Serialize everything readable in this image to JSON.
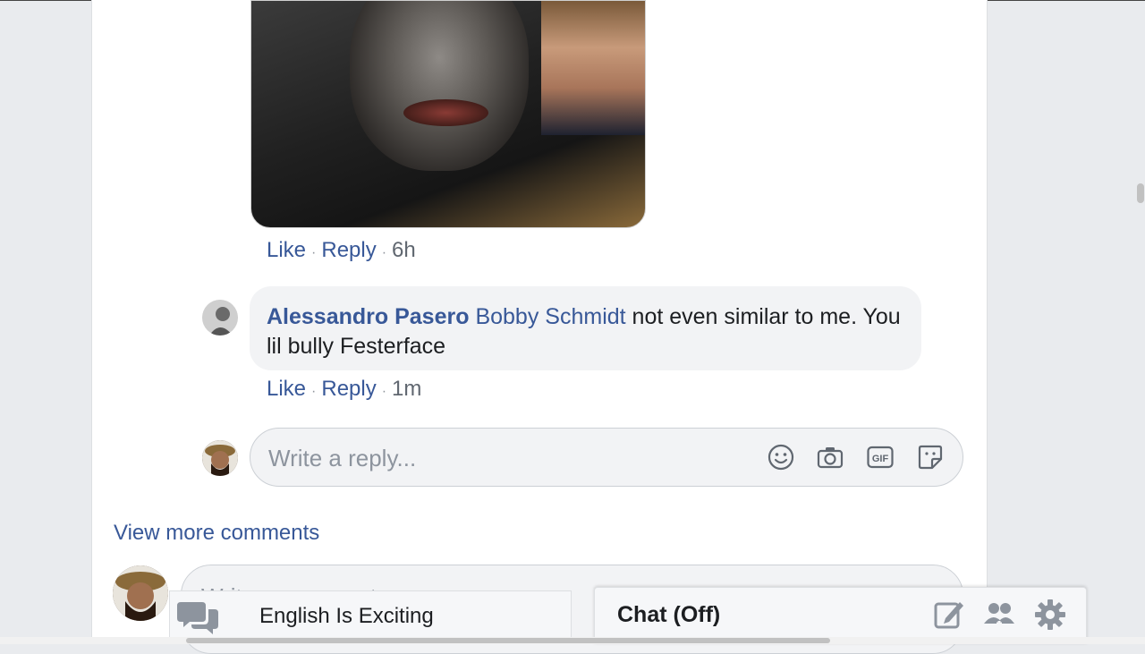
{
  "comments": [
    {
      "actions": {
        "like": "Like",
        "reply": "Reply",
        "time": "6h"
      }
    },
    {
      "author": "Alessandro Pasero",
      "mention": "Bobby Schmidt",
      "text": " not even similar to me. You lil bully Festerface",
      "actions": {
        "like": "Like",
        "reply": "Reply",
        "time": "1m"
      }
    }
  ],
  "reply_box": {
    "placeholder": "Write a reply...",
    "icons": [
      "emoji-icon",
      "camera-icon",
      "gif-icon",
      "sticker-icon"
    ]
  },
  "view_more": "View more comments",
  "comment_box": {
    "placeholder": "Write a comment..."
  },
  "group_chat": {
    "title": "English Is Exciting"
  },
  "chat": {
    "title": "Chat (Off)",
    "icons": [
      "new-message-icon",
      "create-group-icon",
      "gear-icon"
    ]
  },
  "colors": {
    "link": "#385898",
    "bubble": "#f2f3f5",
    "page_bg": "#e9ebee"
  }
}
